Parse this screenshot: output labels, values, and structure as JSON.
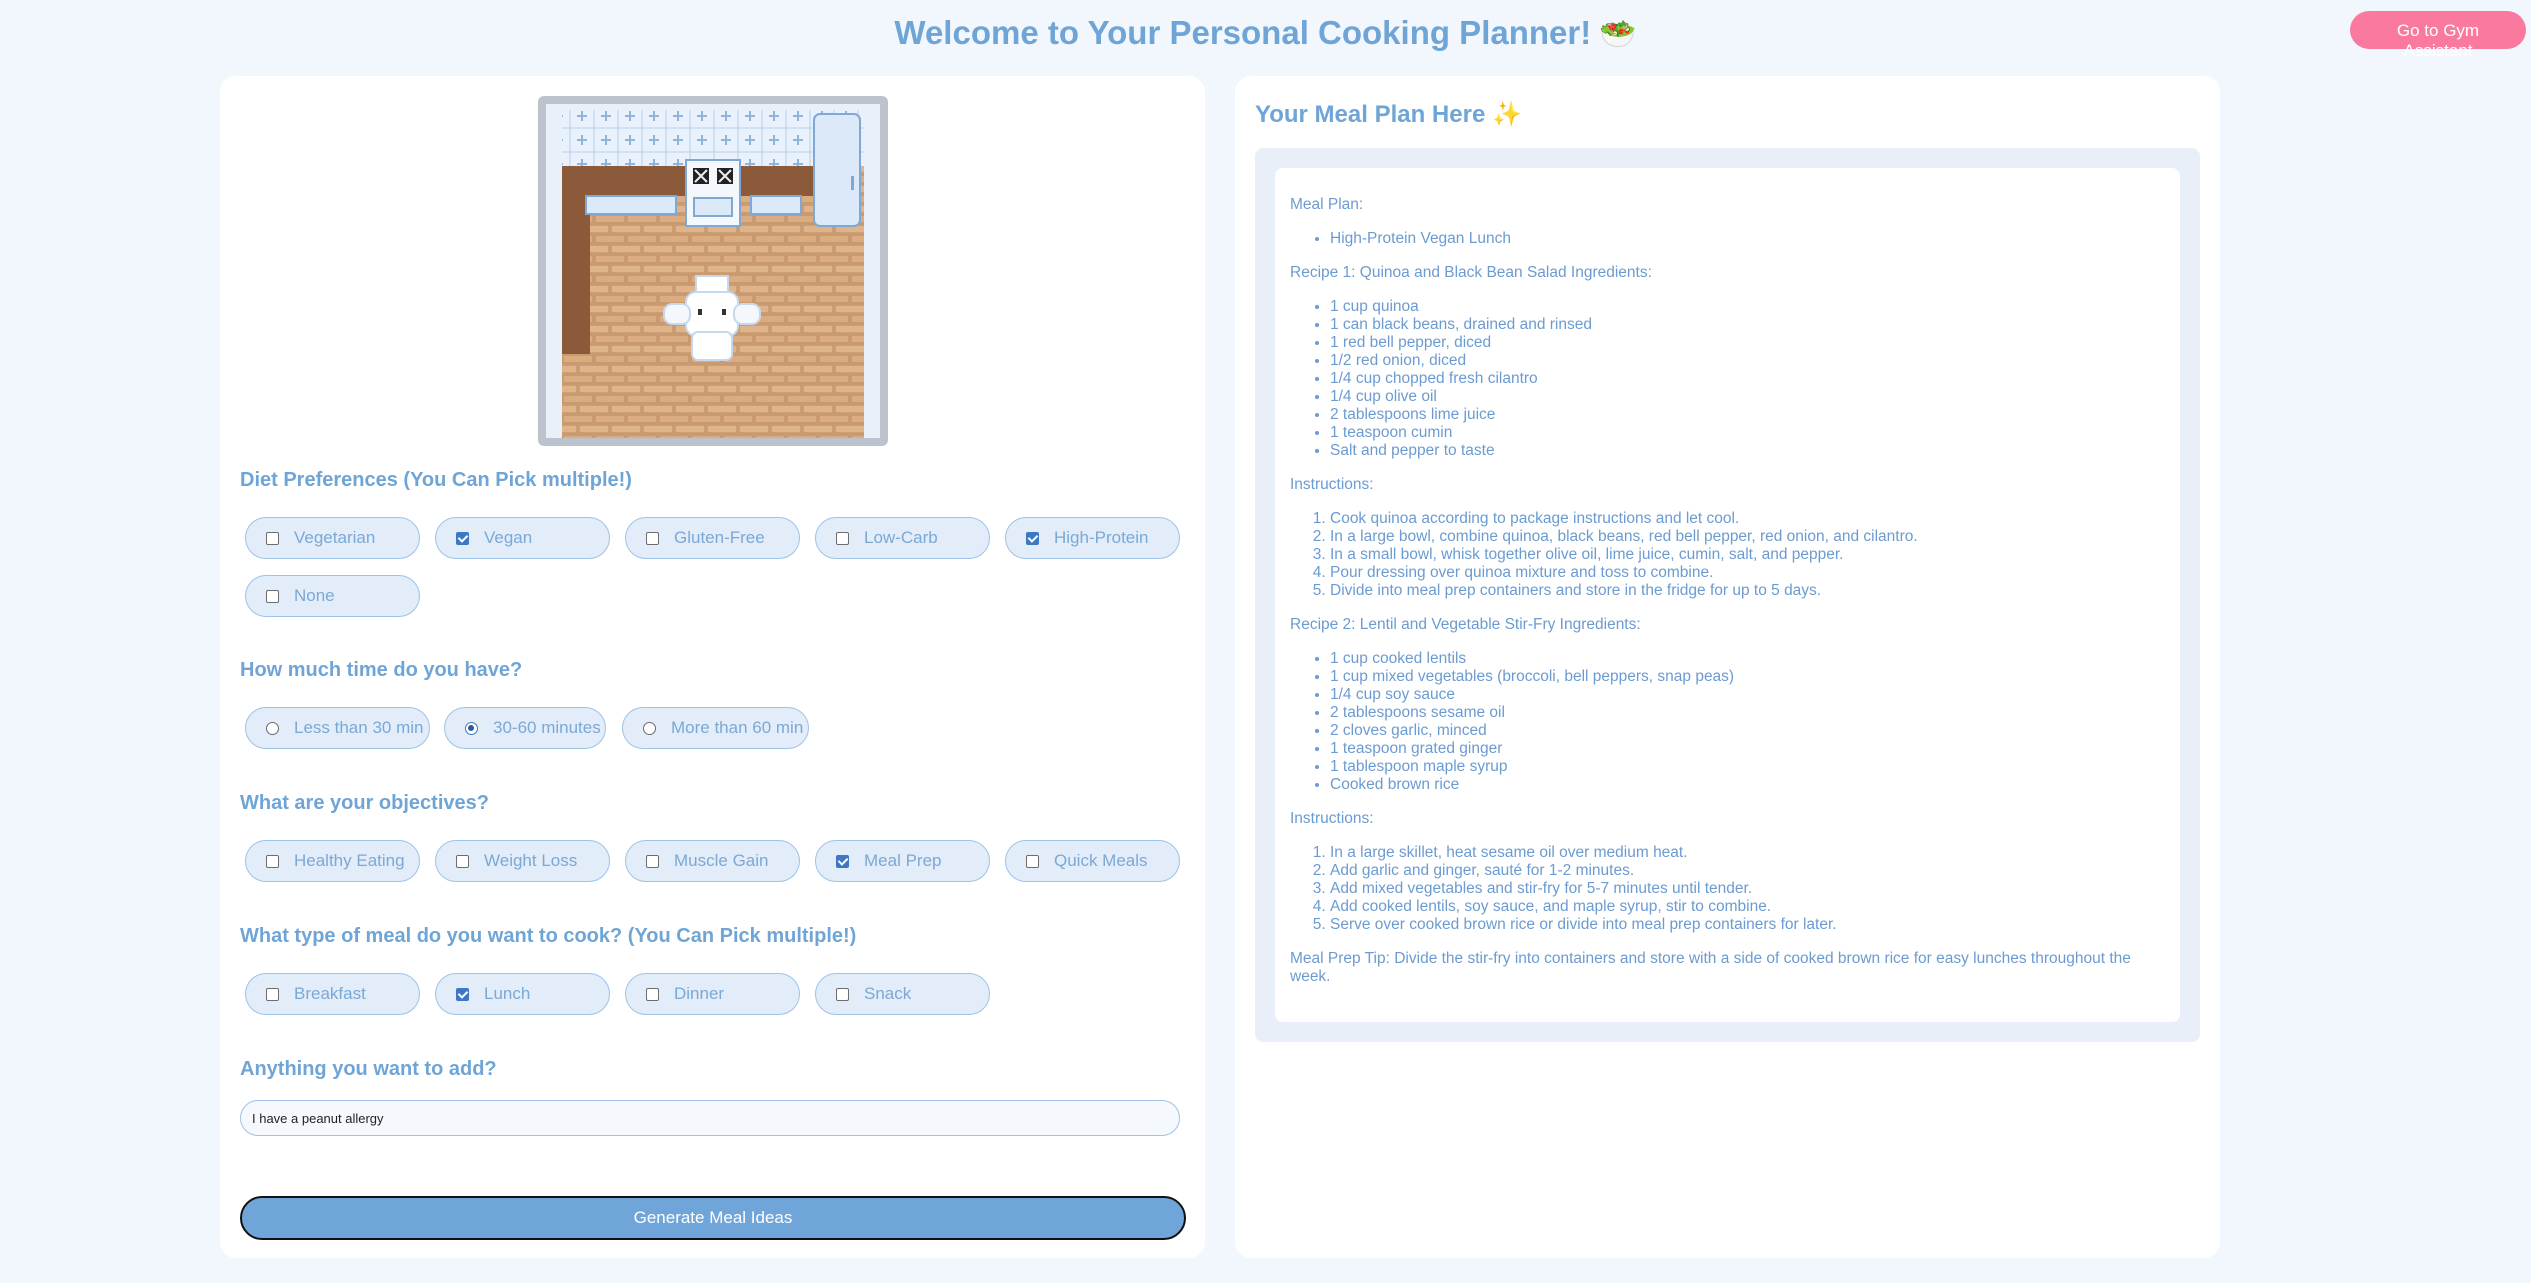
{
  "header": {
    "title": "Welcome to Your Personal Cooking Planner!",
    "title_emoji": "🥗",
    "gym_button": "Go to Gym Assistant"
  },
  "form": {
    "diet": {
      "title": "Diet Preferences (You Can Pick multiple!)",
      "options": [
        {
          "label": "Vegetarian",
          "checked": false
        },
        {
          "label": "Vegan",
          "checked": true
        },
        {
          "label": "Gluten-Free",
          "checked": false
        },
        {
          "label": "Low-Carb",
          "checked": false
        },
        {
          "label": "High-Protein",
          "checked": true
        },
        {
          "label": "None",
          "checked": false
        }
      ]
    },
    "time": {
      "title": "How much time do you have?",
      "options": [
        {
          "label": "Less than 30 min",
          "checked": false
        },
        {
          "label": "30-60 minutes",
          "checked": true
        },
        {
          "label": "More than 60 min",
          "checked": false
        }
      ]
    },
    "objectives": {
      "title": "What are your objectives?",
      "options": [
        {
          "label": "Healthy Eating",
          "checked": false
        },
        {
          "label": "Weight Loss",
          "checked": false
        },
        {
          "label": "Muscle Gain",
          "checked": false
        },
        {
          "label": "Meal Prep",
          "checked": true
        },
        {
          "label": "Quick Meals",
          "checked": false
        }
      ]
    },
    "meal_type": {
      "title": "What type of meal do you want to cook? (You Can Pick multiple!)",
      "options": [
        {
          "label": "Breakfast",
          "checked": false
        },
        {
          "label": "Lunch",
          "checked": true
        },
        {
          "label": "Dinner",
          "checked": false
        },
        {
          "label": "Snack",
          "checked": false
        }
      ]
    },
    "extra": {
      "title": "Anything you want to add?",
      "value": "I have a peanut allergy"
    },
    "generate_button": "Generate Meal Ideas"
  },
  "plan": {
    "title": "Your Meal Plan Here",
    "title_emoji": "✨",
    "heading": "Meal Plan:",
    "plan_items": [
      "High-Protein Vegan Lunch"
    ],
    "recipe1_heading": "Recipe 1: Quinoa and Black Bean Salad Ingredients:",
    "recipe1_ingredients": [
      "1 cup quinoa",
      "1 can black beans, drained and rinsed",
      "1 red bell pepper, diced",
      "1/2 red onion, diced",
      "1/4 cup chopped fresh cilantro",
      "1/4 cup olive oil",
      "2 tablespoons lime juice",
      "1 teaspoon cumin",
      "Salt and pepper to taste"
    ],
    "recipe1_instructions_heading": "Instructions:",
    "recipe1_instructions": [
      "Cook quinoa according to package instructions and let cool.",
      "In a large bowl, combine quinoa, black beans, red bell pepper, red onion, and cilantro.",
      "In a small bowl, whisk together olive oil, lime juice, cumin, salt, and pepper.",
      "Pour dressing over quinoa mixture and toss to combine.",
      "Divide into meal prep containers and store in the fridge for up to 5 days."
    ],
    "recipe2_heading": "Recipe 2: Lentil and Vegetable Stir-Fry Ingredients:",
    "recipe2_ingredients": [
      "1 cup cooked lentils",
      "1 cup mixed vegetables (broccoli, bell peppers, snap peas)",
      "1/4 cup soy sauce",
      "2 tablespoons sesame oil",
      "2 cloves garlic, minced",
      "1 teaspoon grated ginger",
      "1 tablespoon maple syrup",
      "Cooked brown rice"
    ],
    "recipe2_instructions_heading": "Instructions:",
    "recipe2_instructions": [
      "In a large skillet, heat sesame oil over medium heat.",
      "Add garlic and ginger, sauté for 1-2 minutes.",
      "Add mixed vegetables and stir-fry for 5-7 minutes until tender.",
      "Add cooked lentils, soy sauce, and maple syrup, stir to combine.",
      "Serve over cooked brown rice or divide into meal prep containers for later."
    ],
    "tip": "Meal Prep Tip: Divide the stir-fry into containers and store with a side of cooked brown rice for easy lunches throughout the week."
  }
}
